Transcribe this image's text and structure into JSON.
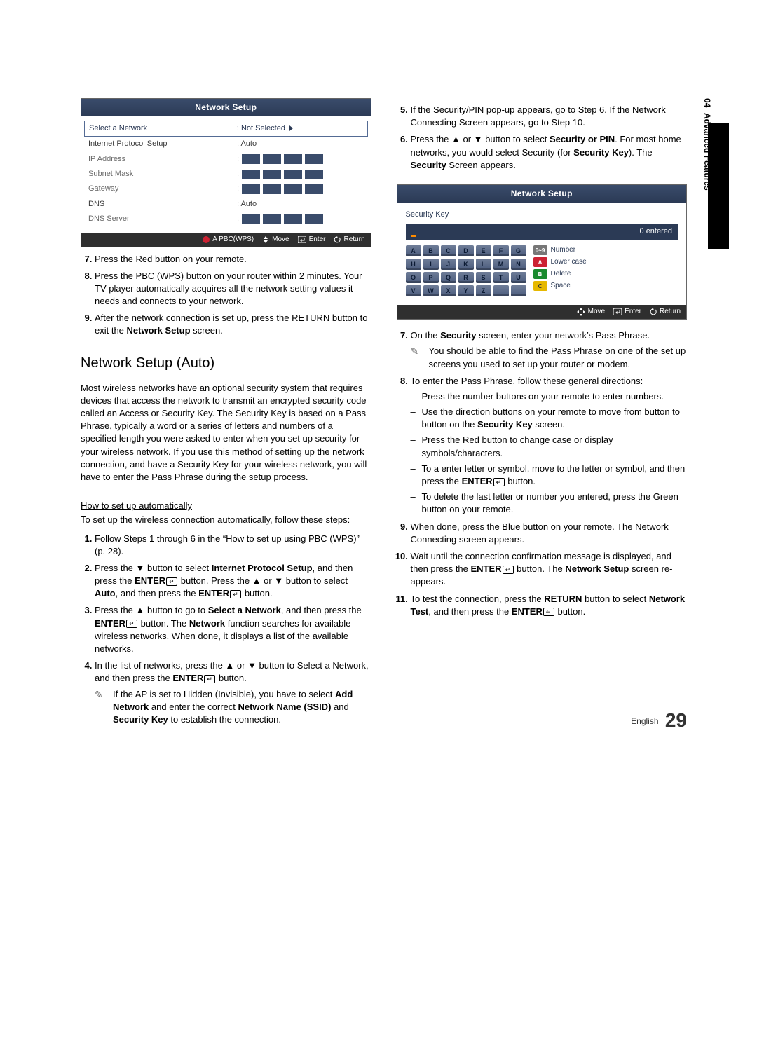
{
  "side": {
    "chapter_num": "04",
    "chapter_label": "Advanced Features"
  },
  "osd1": {
    "title": "Network Setup",
    "rows": [
      {
        "k": "Select a Network",
        "v": ": Not Selected",
        "arrow": true,
        "selected": true
      },
      {
        "k": "Internet Protocol Setup",
        "v": ": Auto",
        "dark": true
      },
      {
        "k": "IP Address",
        "v_ip": true
      },
      {
        "k": "Subnet Mask",
        "v_ip": true
      },
      {
        "k": "Gateway",
        "v_ip": true
      },
      {
        "k": "DNS",
        "v": ": Auto",
        "dark": true
      },
      {
        "k": "DNS Server",
        "v_ip": true
      }
    ],
    "footer": [
      "A PBC(WPS)",
      "Move",
      "Enter",
      "Return"
    ]
  },
  "osd2": {
    "title": "Network Setup",
    "label": "Security Key",
    "entered": "0 entered",
    "keys": [
      "A",
      "B",
      "C",
      "D",
      "E",
      "F",
      "G",
      "H",
      "I",
      "J",
      "K",
      "L",
      "M",
      "N",
      "O",
      "P",
      "Q",
      "R",
      "S",
      "T",
      "U",
      "V",
      "W",
      "X",
      "Y",
      "Z",
      "",
      ""
    ],
    "side_labels": {
      "num": "Number",
      "lower": "Lower case",
      "del": "Delete",
      "space": "Space"
    },
    "footer": [
      "Move",
      "Enter",
      "Return"
    ]
  },
  "left_steps_a": [
    "Press the Red button on your remote.",
    "Press the PBC (WPS) button on your router within 2 minutes. Your TV player automatically acquires all the network setting values it needs and connects to your network.",
    "After the network connection is set up, press the RETURN button to exit the <b>Network Setup</b> screen."
  ],
  "section_auto_title": "Network Setup (Auto)",
  "auto_intro": "Most wireless networks have an optional security system that requires devices that access the network to transmit an encrypted security code called an Access or Security Key. The Security Key is based on a Pass Phrase, typically a word or a series of letters and numbers of a specified length you were asked to enter when you set up security for your wireless network.  If you use this method of setting up the network connection, and have a Security Key for your wireless network, you will have to enter the Pass Phrase during the setup process.",
  "howto_label": "How to set up automatically",
  "howto_lead": "To set up the wireless connection automatically, follow these steps:",
  "howto_steps": [
    "Follow Steps 1 through 6 in the “How to set up using PBC (WPS)” (p. 28).",
    "Press the ▼ button to select <b>Internet Protocol Setup</b>, and then press the <b>ENTER</b><span class='enter-icon' data-name='enter-icon' data-interactable='false'></span> button. Press the ▲ or ▼ button to select <b>Auto</b>, and then press the <b>ENTER</b><span class='enter-icon' data-name='enter-icon' data-interactable='false'></span> button.",
    "Press the ▲ button to go to <b>Select a Network</b>, and then press the <b>ENTER</b><span class='enter-icon' data-name='enter-icon' data-interactable='false'></span> button. The <b>Network</b> function searches for available wireless networks. When done, it displays a list of the available networks.",
    "In the list of networks, press the ▲ or ▼ button to Select a Network, and then press the <b>ENTER</b><span class='enter-icon' data-name='enter-icon' data-interactable='false'></span> button."
  ],
  "howto_note_4": "If the AP is set to Hidden (Invisible), you have to select <b>Add Network</b> and enter the correct <b>Network Name (SSID)</b> and <b>Security Key</b> to establish the connection.",
  "right_steps": [
    "If the Security/PIN pop-up appears, go to Step 6. If the Network Connecting Screen appears, go to Step 10.",
    "Press the ▲ or ▼ button to select <b>Security or PIN</b>. For most home networks, you would select Security (for <b>Security Key</b>). The <b>Security</b> Screen appears."
  ],
  "right_steps_b": [
    "On the <b>Security</b> screen, enter your network’s Pass Phrase.",
    "To enter the Pass Phrase, follow these general directions:",
    "When done, press the Blue button on your remote. The Network Connecting screen appears.",
    "Wait until the connection confirmation message is displayed, and then press the <b>ENTER</b><span class='enter-icon' data-name='enter-icon' data-interactable='false'></span> button. The <b>Network Setup</b> screen re-appears.",
    "To test the connection, press the <b>RETURN</b> button to select <b>Network Test</b>, and then press the <b>ENTER</b><span class='enter-icon' data-name='enter-icon' data-interactable='false'></span> button."
  ],
  "right_note_7": "You should be able to find the Pass Phrase on one of the set up screens you used to set up your router or modem.",
  "right_sub_8": [
    "Press the number buttons on your remote to enter numbers.",
    "Use the direction buttons on your remote to move from button to button on the <b>Security Key</b> screen.",
    "Press the Red button to change case or display symbols/characters.",
    "To a enter letter or symbol, move to the letter or symbol, and then press the <b>ENTER</b><span class='enter-icon' data-name='enter-icon' data-interactable='false'></span> button.",
    "To delete the last letter or number you entered, press the Green button on your remote."
  ],
  "footer": {
    "lang": "English",
    "page": "29"
  }
}
